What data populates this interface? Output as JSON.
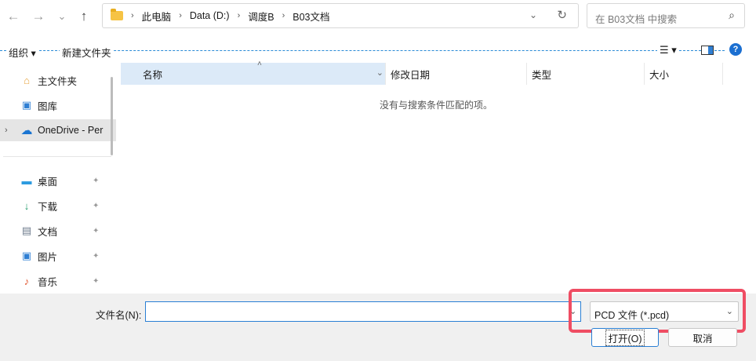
{
  "nav": {
    "back_icon": "←",
    "forward_icon": "→",
    "recent_icon": "⌄",
    "up_icon": "↑"
  },
  "address": {
    "breadcrumbs": [
      "此电脑",
      "Data (D:)",
      "调度B",
      "B03文档"
    ],
    "separator": "›",
    "dropdown_icon": "⌄",
    "refresh_icon": "↻"
  },
  "search": {
    "placeholder": "在 B03文档 中搜索",
    "icon": "⌕"
  },
  "toolbar": {
    "organize_label": "组织 ▾",
    "new_folder_label": "新建文件夹",
    "view_icon": "☰ ▾",
    "help_icon": "?"
  },
  "sidebar": {
    "items": [
      {
        "label": "主文件夹",
        "icon": "⌂",
        "icon_color": "#e8a33d",
        "pinned": false
      },
      {
        "label": "图库",
        "icon": "▣",
        "icon_color": "#2f7fd3",
        "pinned": false
      },
      {
        "label": "OneDrive - Per",
        "icon": "☁",
        "icon_color": "#1a75d2",
        "pinned": false,
        "expandable": true,
        "selected": true
      },
      {
        "label": "桌面",
        "icon": "▬",
        "icon_color": "#2c9be0",
        "pinned": true
      },
      {
        "label": "下载",
        "icon": "↓",
        "icon_color": "#1f9a6a",
        "pinned": true
      },
      {
        "label": "文档",
        "icon": "▤",
        "icon_color": "#6d7b8d",
        "pinned": true
      },
      {
        "label": "图片",
        "icon": "▣",
        "icon_color": "#2f7fd3",
        "pinned": true
      },
      {
        "label": "音乐",
        "icon": "♪",
        "icon_color": "#e1542d",
        "pinned": true
      }
    ],
    "expand_icon": "›",
    "pin_icon": "✦"
  },
  "filelist": {
    "columns": [
      "名称",
      "修改日期",
      "类型",
      "大小"
    ],
    "sort_icon": "˄",
    "empty_message": "没有与搜索条件匹配的项。"
  },
  "bottom": {
    "filename_label": "文件名(N):",
    "filename_value": "",
    "filetype_value": "PCD 文件 (*.pcd)",
    "open_label": "打开(O)",
    "cancel_label": "取消",
    "highlight_color": "#ef4d63"
  }
}
